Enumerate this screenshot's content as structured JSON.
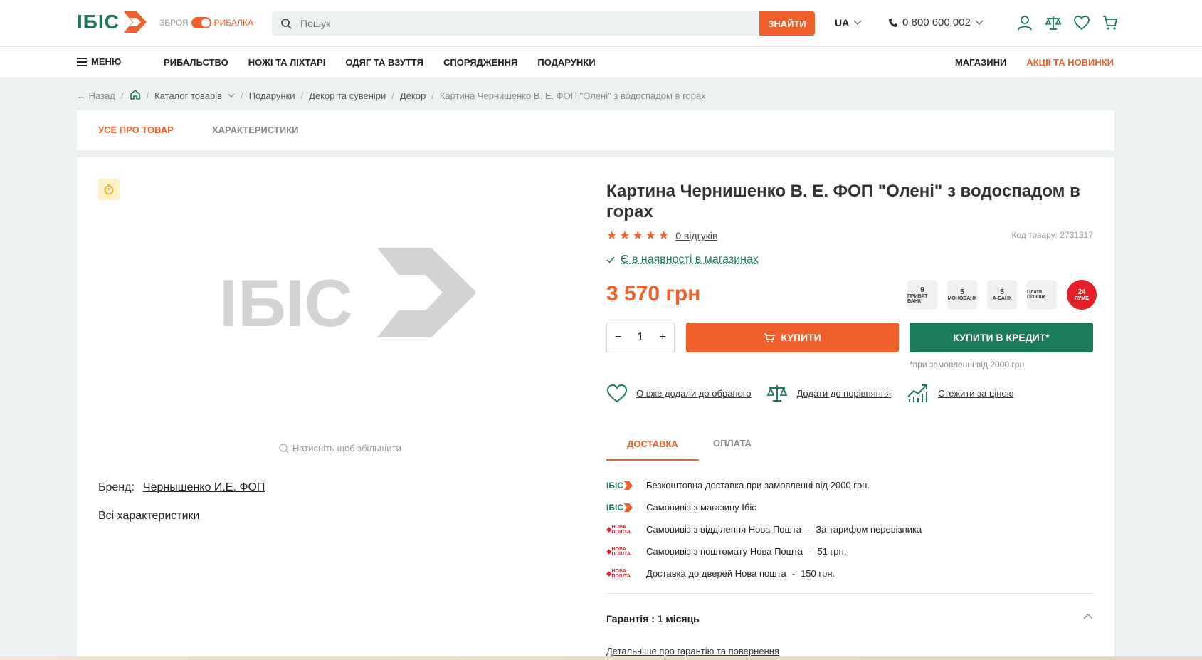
{
  "header": {
    "logo_text": "ІБІС",
    "toggle_left": "ЗБРОЯ",
    "toggle_right": "РИБАЛКА",
    "search_placeholder": "Пошук",
    "search_button": "ЗНАЙТИ",
    "lang": "UA",
    "phone": "0 800 600 002"
  },
  "nav": {
    "menu_label": "МЕНЮ",
    "items": [
      "РИБАЛЬСТВО",
      "НОЖІ ТА ЛІХТАРІ",
      "ОДЯГ ТА ВЗУТТЯ",
      "СПОРЯДЖЕННЯ",
      "ПОДАРУНКИ"
    ],
    "stores": "МАГАЗИНИ",
    "promo": "АКЦІЇ ТА НОВИНКИ"
  },
  "breadcrumbs": {
    "back": "Назад",
    "items": [
      "Каталог товарів",
      "Подарунки",
      "Декор та сувеніри",
      "Декор"
    ],
    "current": "Картина Чернишенко В. Е. ФОП \"Олені\" з водоспадом в горах"
  },
  "tabs": {
    "about": "УСЕ ПРО ТОВАР",
    "specs": "ХАРАКТЕРИСТИКИ"
  },
  "gallery": {
    "placeholder_logo": "ІБІС",
    "zoom_hint": "Натисніть щоб збільшити"
  },
  "brand": {
    "label": "Бренд:",
    "value": "Чернышенко И.Е. ФОП"
  },
  "all_specs": "Всі характеристики",
  "product": {
    "title": "Картина Чернишенко В. Е. ФОП \"Олені\" з водоспадом в горах",
    "stars": "★★★★★",
    "reviews": "0 відгуків",
    "sku": "Код товару: 2731317",
    "stock": "Є в наявності в магазинах",
    "price": "3 570 грн",
    "qty": "1",
    "buy": "КУПИТИ",
    "credit": "КУПИТИ В КРЕДИТ*",
    "credit_note": "*при замовленні від 2000 грн"
  },
  "banks": [
    {
      "top": "9",
      "bottom": "ПРИВАТ БАНК"
    },
    {
      "top": "5",
      "bottom": "МОНОБАНК"
    },
    {
      "top": "5",
      "bottom": "А-БАНК"
    },
    {
      "top": "",
      "bottom": "Плати Пізніше"
    },
    {
      "top": "24",
      "bottom": "ПУМБ"
    }
  ],
  "actions": {
    "favorite": "О вже додали до обраного",
    "compare": "Додати до порівняння",
    "price_watch": "Стежити за ціною"
  },
  "pay_tabs": {
    "delivery": "ДОСТАВКА",
    "payment": "ОПЛАТА"
  },
  "delivery": [
    {
      "logo": "ІБІС",
      "text": "Безкоштовна доставка при замовленні від 2000 грн.",
      "sep": "",
      "price": ""
    },
    {
      "logo": "ІБІС",
      "text": "Самовивіз з магазину Ібіс",
      "sep": "",
      "price": ""
    },
    {
      "logo": "НОВА ПОШТА",
      "text": "Самовивіз з відділення Нова Пошта",
      "sep": "-",
      "price": "За тарифом перевізника"
    },
    {
      "logo": "НОВА ПОШТА",
      "text": "Самовивіз з поштомату Нова Пошта",
      "sep": "-",
      "price": "51 грн."
    },
    {
      "logo": "НОВА ПОШТА",
      "text": "Доставка до дверей Нова пошта",
      "sep": "-",
      "price": "150 грн."
    }
  ],
  "warranty": {
    "title": "Гарантія : 1 місяць",
    "link": "Детальніше про гарантію та повернення"
  },
  "colors": {
    "accent": "#f0602a",
    "brand_green": "#1a7a5a"
  }
}
